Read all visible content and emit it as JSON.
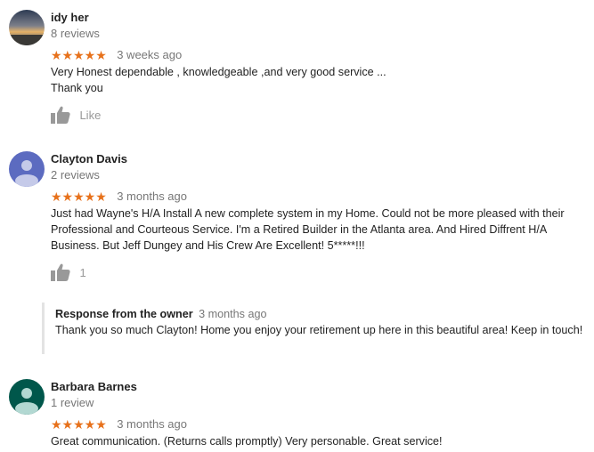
{
  "reviews": [
    {
      "name": "idy her",
      "review_count": "8 reviews",
      "rating": 5,
      "stars": "★★★★★",
      "date": "3 weeks ago",
      "text_line1": "Very Honest dependable , knowledgeable ,and very good service ...",
      "text_line2": "Thank you",
      "like_label": "Like",
      "avatar": "photo-sunset"
    },
    {
      "name": "Clayton Davis",
      "review_count": "2 reviews",
      "rating": 5,
      "stars": "★★★★★",
      "date": "3 months ago",
      "text": "Just had Wayne's H/A Install A new complete system in my Home. Could not be more pleased with their Professional and Courteous Service. I'm a Retired Builder in the Atlanta area. And Hired Diffrent H/A Business.  But  Jeff Dungey and His Crew Are Excellent! 5*****!!!",
      "like_label": "1",
      "avatar": "default-person",
      "avatar_color": "#5c6bc0",
      "owner_response": {
        "title": "Response from the owner",
        "date": "3 months ago",
        "text": "Thank you so much Clayton! Home you enjoy your retirement up here in this beautiful area! Keep in touch!"
      }
    },
    {
      "name": "Barbara Barnes",
      "review_count": "1 review",
      "rating": 5,
      "stars": "★★★★★",
      "date": "3 months ago",
      "text": "Great communication. (Returns calls promptly) Very personable. Great service!",
      "avatar": "default-person",
      "avatar_color": "#00574b"
    }
  ],
  "colors": {
    "star": "#e7711b",
    "muted_text": "#777777",
    "like_icon": "#999999"
  }
}
